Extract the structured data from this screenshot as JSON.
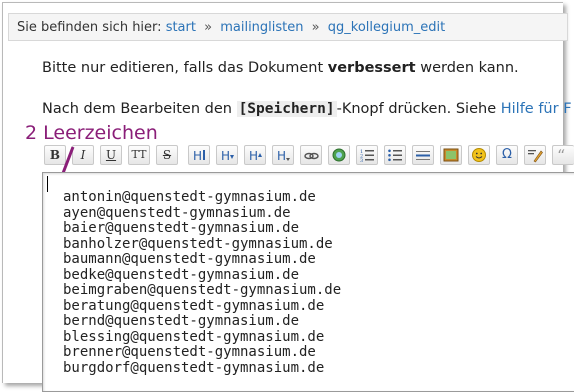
{
  "breadcrumb": {
    "prefix": "Sie befinden sich hier:",
    "items": [
      "start",
      "mailinglisten",
      "qg_kollegium_edit"
    ],
    "separator": "»"
  },
  "intro": {
    "line1_before": "Bitte nur editieren, falls das Dokument ",
    "line1_bold": "verbessert",
    "line1_after": " werden kann.",
    "line2_before": "Nach dem Bearbeiten den ",
    "line2_code": "[Speichern]",
    "line2_after": "-Knopf drücken. Siehe ",
    "line2_link": "Hilfe für F"
  },
  "annotation": {
    "text": "2 Leerzeichen",
    "color": "#8a1e78"
  },
  "toolbar": {
    "bold_label": "B",
    "italic_label": "I",
    "underline_label": "U",
    "mono_label": "TT",
    "strike_label": "S"
  },
  "editor": {
    "lines": [
      "antonin@quenstedt-gymnasium.de",
      "ayen@quenstedt-gymnasium.de",
      "baier@quenstedt-gymnasium.de",
      "banholzer@quenstedt-gymnasium.de",
      "baumann@quenstedt-gymnasium.de",
      "bedke@quenstedt-gymnasium.de",
      "beimgraben@quenstedt-gymnasium.de",
      "beratung@quenstedt-gymnasium.de",
      "bernd@quenstedt-gymnasium.de",
      "blessing@quenstedt-gymnasium.de",
      "brenner@quenstedt-gymnasium.de",
      "burgdorf@quenstedt-gymnasium.de"
    ]
  },
  "colors": {
    "link": "#2b73b7",
    "annotation": "#8a1e78"
  }
}
